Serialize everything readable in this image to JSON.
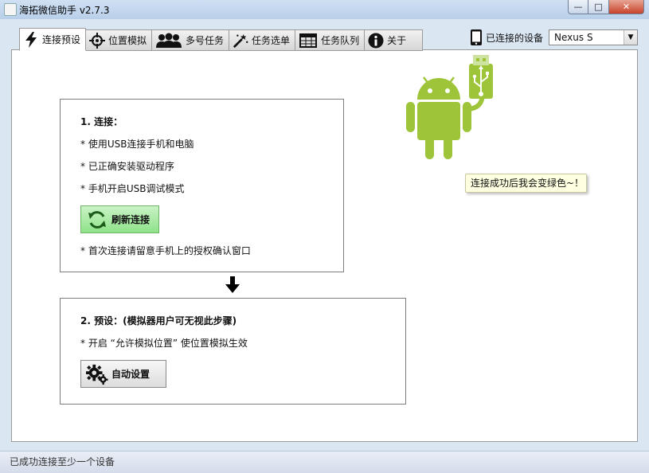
{
  "window": {
    "title": "海拓微信助手 v2.7.3",
    "controls": {
      "minimize": "—",
      "maximize": "□",
      "close": "✕"
    }
  },
  "tabs": [
    {
      "label": "连接预设",
      "icon": "lightning-icon",
      "active": true
    },
    {
      "label": "位置模拟",
      "icon": "crosshair-icon",
      "active": false
    },
    {
      "label": "多号任务",
      "icon": "users-icon",
      "active": false
    },
    {
      "label": "任务选单",
      "icon": "magic-wand-icon",
      "active": false
    },
    {
      "label": "任务队列",
      "icon": "table-icon",
      "active": false
    },
    {
      "label": "关于",
      "icon": "info-icon",
      "active": false
    }
  ],
  "device": {
    "label": "已连接的设备",
    "selected": "Nexus S",
    "icon": "phone-icon"
  },
  "step1": {
    "heading": "1. 连接：",
    "lines": [
      " * 使用USB连接手机和电脑",
      " * 已正确安装驱动程序",
      " * 手机开启USB调试模式"
    ],
    "button_label": "刷新连接",
    "note": "* 首次连接请留意手机上的授权确认窗口"
  },
  "step2": {
    "heading": "2. 预设：(模拟器用户可无视此步骤)",
    "line": " * 开启 “允许模拟位置” 使位置模拟生效",
    "button_label": "自动设置"
  },
  "tooltip": "连接成功后我会变绿色~！",
  "status": "已成功连接至少一个设备",
  "colors": {
    "android_green": "#9ec43a",
    "refresh_button": "#a8eaa3",
    "tooltip_bg": "#ffffe1"
  }
}
